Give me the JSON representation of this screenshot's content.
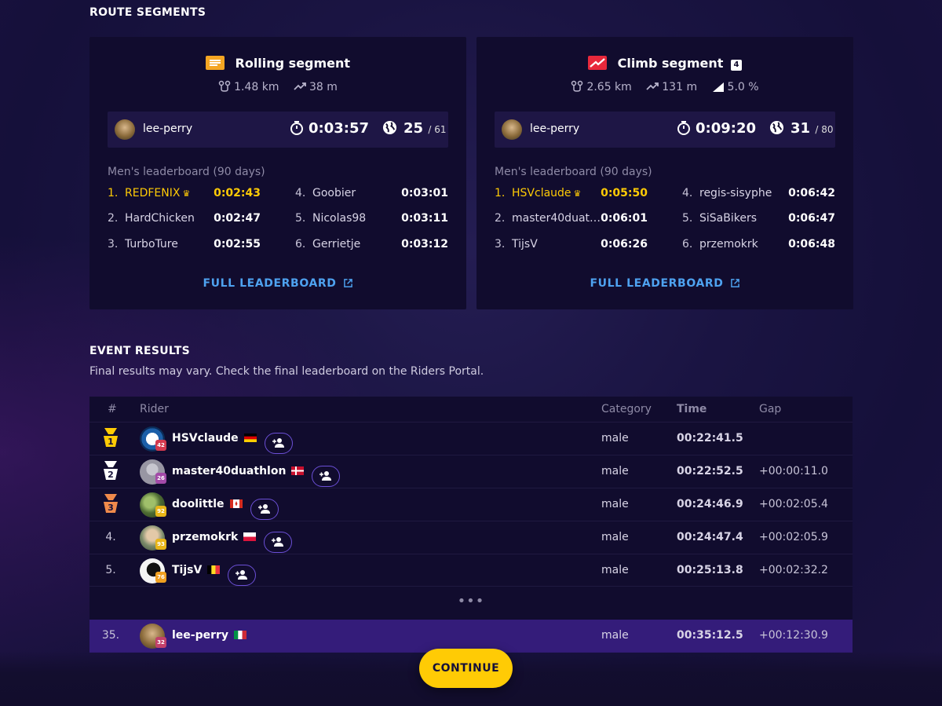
{
  "route_segments_title": "ROUTE SEGMENTS",
  "segments": [
    {
      "name": "Rolling segment",
      "icon": "rolling-segment-icon",
      "distance": "1.48 km",
      "elevation": "38 m",
      "me": {
        "user": "lee-perry",
        "time": "0:03:57",
        "rank": "25",
        "total": "/ 61"
      },
      "leaderboard_title": "Men's leaderboard (90 days)",
      "leaders": [
        {
          "pos": "1.",
          "name": "REDFENIX",
          "time": "0:02:43"
        },
        {
          "pos": "2.",
          "name": "HardChicken",
          "time": "0:02:47"
        },
        {
          "pos": "3.",
          "name": "TurboTure",
          "time": "0:02:55"
        },
        {
          "pos": "4.",
          "name": "Goobier",
          "time": "0:03:01"
        },
        {
          "pos": "5.",
          "name": "Nicolas98",
          "time": "0:03:11"
        },
        {
          "pos": "6.",
          "name": "Gerrietje",
          "time": "0:03:12"
        }
      ],
      "full_leaderboard": "FULL LEADERBOARD"
    },
    {
      "name": "Climb segment",
      "category": "4",
      "icon": "climb-segment-icon",
      "distance": "2.65 km",
      "elevation": "131 m",
      "gradient": "5.0 %",
      "me": {
        "user": "lee-perry",
        "time": "0:09:20",
        "rank": "31",
        "total": "/ 80"
      },
      "leaderboard_title": "Men's leaderboard (90 days)",
      "leaders": [
        {
          "pos": "1.",
          "name": "HSVclaude",
          "time": "0:05:50"
        },
        {
          "pos": "2.",
          "name": "master40duat…",
          "time": "0:06:01"
        },
        {
          "pos": "3.",
          "name": "TijsV",
          "time": "0:06:26"
        },
        {
          "pos": "4.",
          "name": "regis-sisyphe",
          "time": "0:06:42"
        },
        {
          "pos": "5.",
          "name": "SiSaBikers",
          "time": "0:06:47"
        },
        {
          "pos": "6.",
          "name": "przemokrk",
          "time": "0:06:48"
        }
      ],
      "full_leaderboard": "FULL LEADERBOARD"
    }
  ],
  "event_results_title": "EVENT RESULTS",
  "event_results_subtitle": "Final results may vary. Check the final leaderboard on the Riders Portal.",
  "table": {
    "headers": {
      "pos": "#",
      "rider": "Rider",
      "category": "Category",
      "time": "Time",
      "gap": "Gap"
    },
    "rows": [
      {
        "pos": "1",
        "name": "HSVclaude",
        "level": "42",
        "flag": "DE",
        "category": "male",
        "time": "00:22:41.5",
        "gap": ""
      },
      {
        "pos": "2",
        "name": "master40duathlon",
        "level": "26",
        "flag": "DK",
        "category": "male",
        "time": "00:22:52.5",
        "gap": "+00:00:11.0"
      },
      {
        "pos": "3",
        "name": "doolittle",
        "level": "92",
        "flag": "CA",
        "category": "male",
        "time": "00:24:46.9",
        "gap": "+00:02:05.4"
      },
      {
        "pos": "4.",
        "name": "przemokrk",
        "level": "93",
        "flag": "PL",
        "category": "male",
        "time": "00:24:47.4",
        "gap": "+00:02:05.9"
      },
      {
        "pos": "5.",
        "name": "TijsV",
        "level": "76",
        "flag": "BE",
        "category": "male",
        "time": "00:25:13.8",
        "gap": "+00:02:32.2"
      }
    ],
    "ellipsis": "•••",
    "me_row": {
      "pos": "35.",
      "name": "lee-perry",
      "level": "32",
      "flag": "IT",
      "category": "male",
      "time": "00:35:12.5",
      "gap": "+00:12:30.9"
    }
  },
  "continue_label": "CONTINUE",
  "colors": {
    "accent_gold": "#ffcb05",
    "link_blue": "#4ea2f0",
    "highlight_row": "#341c7a",
    "card_bg": "#110c2e"
  }
}
